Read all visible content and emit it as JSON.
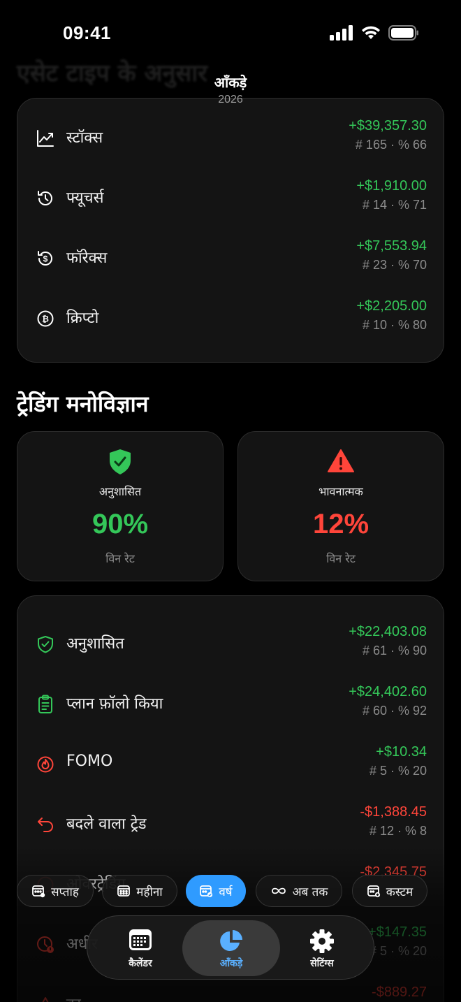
{
  "status": {
    "time": "09:41"
  },
  "nav": {
    "title": "आँकड़े",
    "subtitle": "2026"
  },
  "ghost_header": "एसेट टाइप के अनुसार",
  "asset_types": [
    {
      "label": "स्टॉक्स",
      "value": "+$39,357.30",
      "meta": "# 165 · % 66",
      "icon": "chart-line-icon",
      "tone": "green"
    },
    {
      "label": "फ्यूचर्स",
      "value": "+$1,910.00",
      "meta": "# 14 · % 71",
      "icon": "history-icon",
      "tone": "green"
    },
    {
      "label": "फॉरेक्स",
      "value": "+$7,553.94",
      "meta": "# 23 · % 70",
      "icon": "dollar-cycle-icon",
      "tone": "green"
    },
    {
      "label": "क्रिप्टो",
      "value": "+$2,205.00",
      "meta": "# 10 · % 80",
      "icon": "bitcoin-icon",
      "tone": "green"
    }
  ],
  "psychology": {
    "title": "ट्रेडिंग मनोविज्ञान",
    "disciplined": {
      "label": "अनुशासित",
      "value": "90%",
      "sub": "विन रेट"
    },
    "emotional": {
      "label": "भावनात्मक",
      "value": "12%",
      "sub": "विन रेट"
    }
  },
  "psychology_rows": [
    {
      "label": "अनुशासित",
      "value": "+$22,403.08",
      "meta": "# 61 · % 90",
      "icon": "shield-check-icon",
      "tone": "green"
    },
    {
      "label": "प्लान फ़ॉलो किया",
      "value": "+$24,402.60",
      "meta": "# 60 · % 92",
      "icon": "clipboard-icon",
      "tone": "green"
    },
    {
      "label": "FOMO",
      "value": "+$10.34",
      "meta": "# 5 · % 20",
      "icon": "flame-icon",
      "tone": "green"
    },
    {
      "label": "बदले वाला ट्रेड",
      "value": "-$1,388.45",
      "meta": "# 12 · % 8",
      "icon": "revenge-arrow-icon",
      "tone": "red"
    },
    {
      "label": "ओवरट्रेडिंग",
      "value": "-$2,345.75",
      "meta": "",
      "icon": "overtrade-icon",
      "tone": "red"
    },
    {
      "label": "अधीर",
      "value": "+$147.35",
      "meta": "# 5 · % 20",
      "icon": "impatient-clock-icon",
      "tone": "green"
    },
    {
      "label": "डर",
      "value": "-$889.27",
      "meta": "",
      "icon": "warning-icon",
      "tone": "red"
    }
  ],
  "filters": [
    {
      "label": "सप्ताह",
      "icon": "calendar-week-icon",
      "active": false
    },
    {
      "label": "महीना",
      "icon": "calendar-month-icon",
      "active": false
    },
    {
      "label": "वर्ष",
      "icon": "calendar-year-icon",
      "active": true
    },
    {
      "label": "अब तक",
      "icon": "infinity-icon",
      "active": false
    },
    {
      "label": "कस्टम",
      "icon": "calendar-custom-icon",
      "active": false
    }
  ],
  "tabs": [
    {
      "label": "कैलेंडर",
      "icon": "calendar-icon",
      "active": false
    },
    {
      "label": "आँकड़े",
      "icon": "pie-chart-icon",
      "active": true
    },
    {
      "label": "सेटिंग्स",
      "icon": "gear-icon",
      "active": false
    }
  ],
  "colors": {
    "green": "#34c759",
    "red": "#ff453a",
    "accent": "#2f9bff",
    "card": "#141414"
  }
}
